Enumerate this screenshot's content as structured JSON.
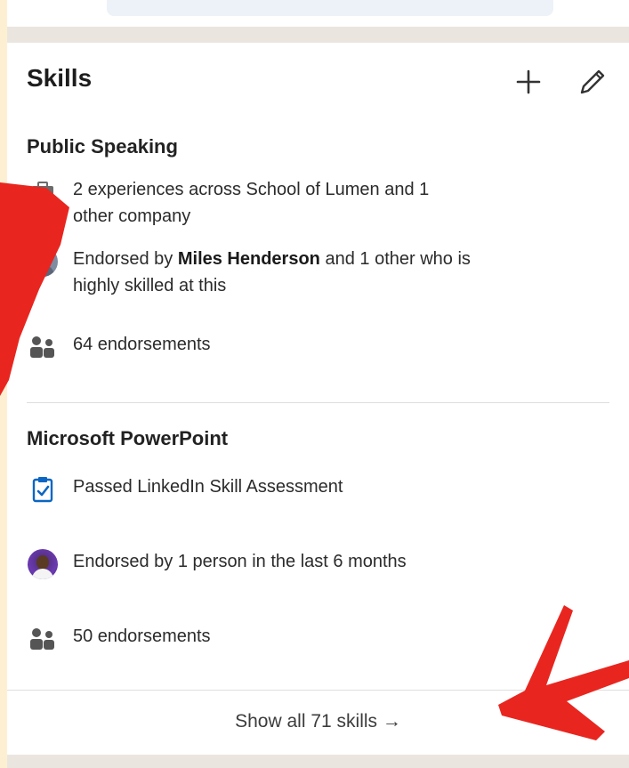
{
  "section": {
    "title": "Skills",
    "add_icon": "plus-icon",
    "edit_icon": "pencil-icon"
  },
  "skills": [
    {
      "name": "Public Speaking",
      "experience": {
        "icon": "experience-icon",
        "line1": "2 experiences across School of Lumen and 1",
        "line2": "other company"
      },
      "endorser": {
        "icon": "endorser-avatar",
        "prefix": "Endorsed by ",
        "name": "Miles Henderson",
        "suffix": " and 1 other who is",
        "line2": "highly skilled at this"
      },
      "endorsements": {
        "icon": "people-icon",
        "text": "64 endorsements"
      }
    },
    {
      "name": "Microsoft PowerPoint",
      "assessment": {
        "icon": "clipboard-check-icon",
        "text": "Passed LinkedIn Skill Assessment"
      },
      "recent": {
        "icon": "endorser-avatar",
        "text": "Endorsed by 1 person in the last 6 months"
      },
      "endorsements": {
        "icon": "people-icon",
        "text": "50 endorsements"
      }
    }
  ],
  "footer": {
    "show_all": "Show all 71 skills →"
  },
  "colors": {
    "page_background": "#fdf0d2",
    "card": "#ffffff",
    "annotation_red": "#e8261f",
    "assessment_blue": "#0a66c2"
  }
}
